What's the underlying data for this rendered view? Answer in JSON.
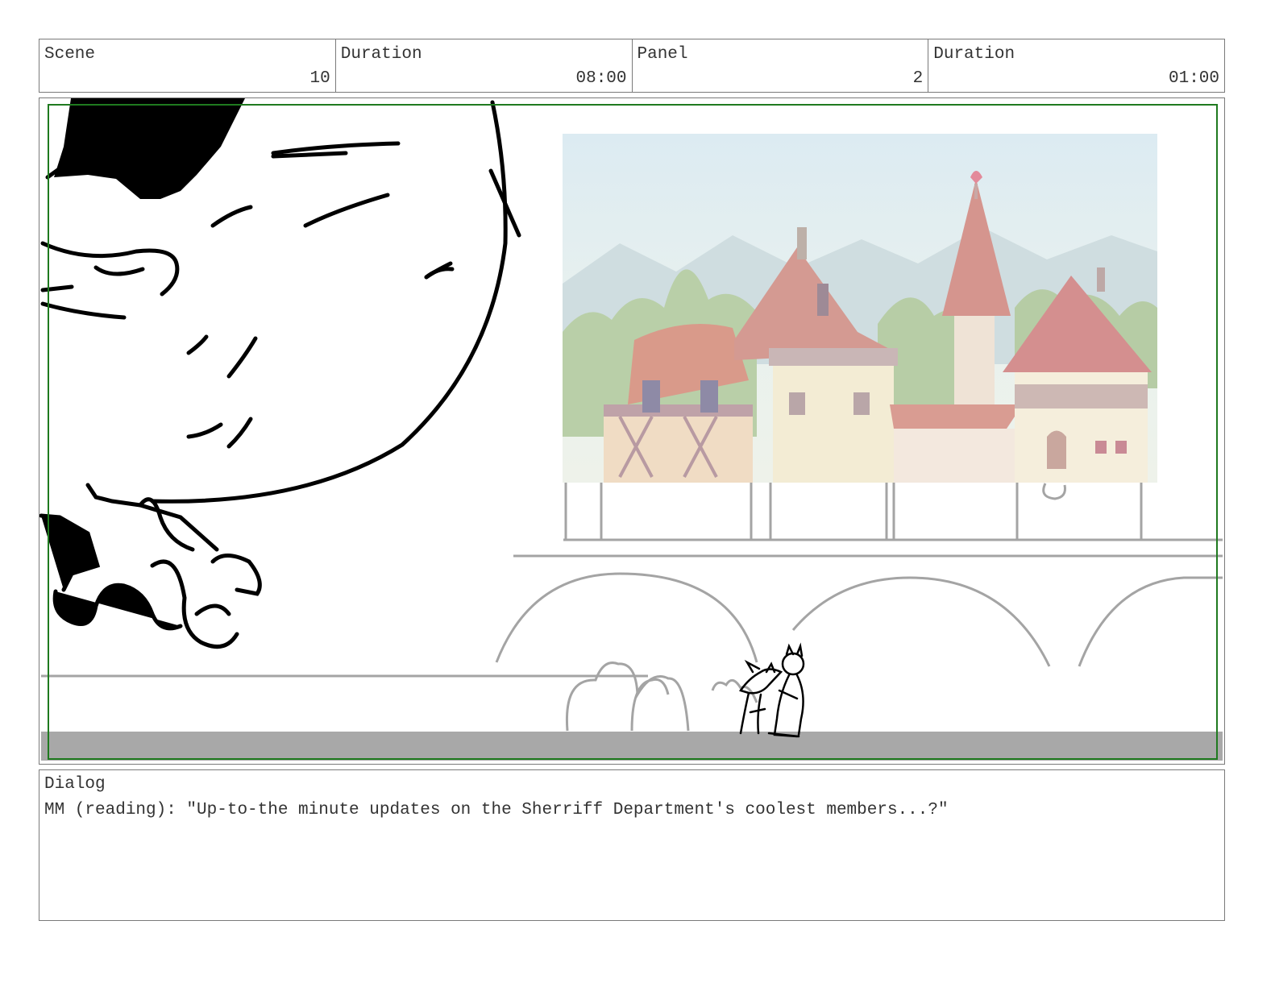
{
  "header": {
    "scene_label": "Scene",
    "scene_value": "10",
    "scene_duration_label": "Duration",
    "scene_duration_value": "08:00",
    "panel_label": "Panel",
    "panel_value": "2",
    "panel_duration_label": "Duration",
    "panel_duration_value": "01:00"
  },
  "dialog": {
    "label": "Dialog",
    "text": "MM (reading): \"Up-to-the minute updates on the Sherriff Department's coolest members...?\""
  },
  "colors": {
    "safe_frame": "#1f7a1f",
    "border": "#7a7a7a",
    "ground_band": "#a8a8a8",
    "sketch_gray": "#a0a0a0",
    "ink": "#000000"
  }
}
